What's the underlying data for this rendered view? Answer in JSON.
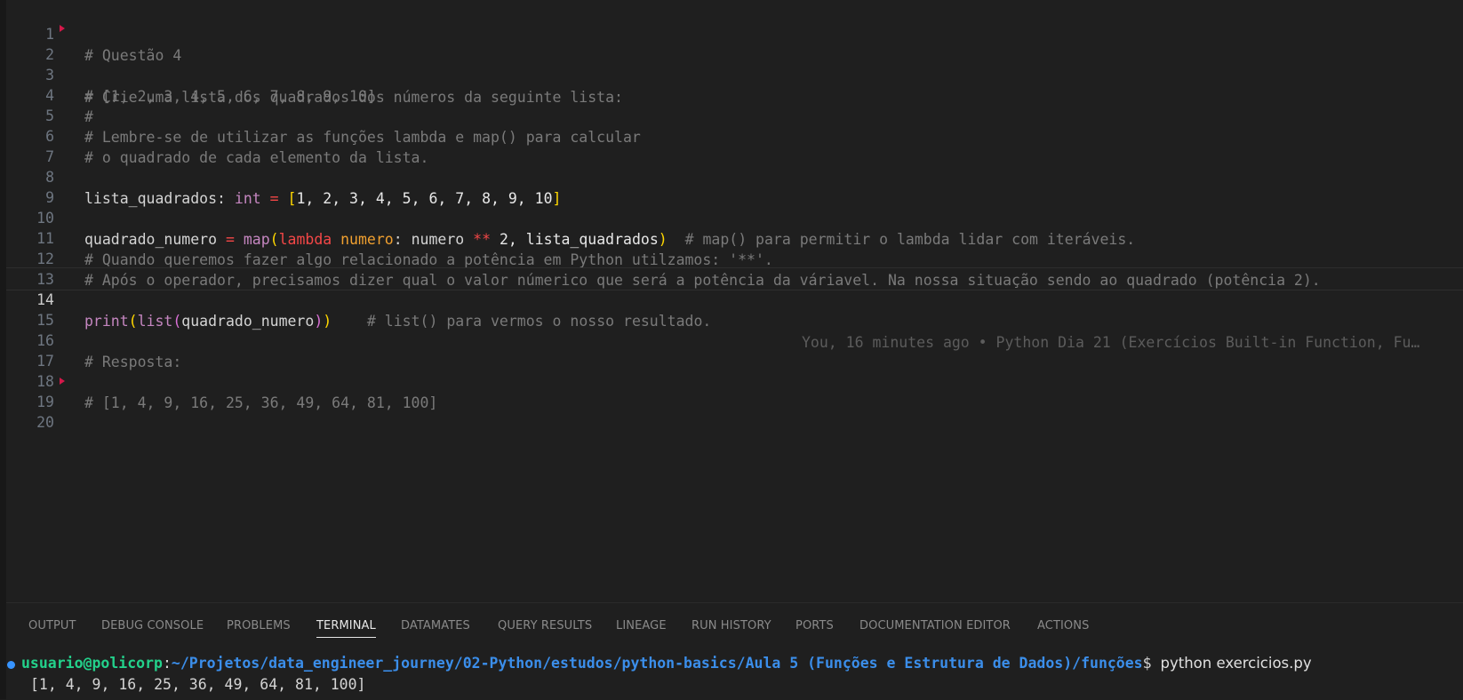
{
  "editor": {
    "active_line": 14,
    "lines": [
      {
        "n": "1",
        "comment": "# Questão 4"
      },
      {
        "n": "2",
        "comment": "# Crie uma lista dos quadrados dos números da seguinte lista:"
      },
      {
        "n": "3",
        "comment": "# [1, 2, 3, 4, 5, 6, 7, 8, 9, 10]"
      },
      {
        "n": "4",
        "comment": "#"
      },
      {
        "n": "5",
        "comment": "# Lembre-se de utilizar as funções lambda e map() para calcular"
      },
      {
        "n": "6",
        "comment": "# o quadrado de cada elemento da lista."
      },
      {
        "n": "7",
        "comment": ""
      },
      {
        "n": "8"
      },
      {
        "n": "9",
        "comment": ""
      },
      {
        "n": "10"
      },
      {
        "n": "11",
        "comment": "# Quando queremos fazer algo relacionado a potência em Python utilzamos: '**'."
      },
      {
        "n": "12",
        "comment": "# Após o operador, precisamos dizer qual o valor númerico que será a potência da váriavel. Na nossa situação sendo ao quadrado (potência 2)."
      },
      {
        "n": "13",
        "comment": ""
      },
      {
        "n": "14"
      },
      {
        "n": "15",
        "comment": ""
      },
      {
        "n": "16",
        "comment": "# Resposta:"
      },
      {
        "n": "17",
        "comment": ""
      },
      {
        "n": "18",
        "comment": "# [1, 4, 9, 16, 25, 36, 49, 64, 81, 100]"
      },
      {
        "n": "19",
        "comment": ""
      },
      {
        "n": "20",
        "comment": ""
      }
    ],
    "line8": {
      "var": "lista_quadrados",
      "colon": ": ",
      "type": "int",
      "eq": " = ",
      "open": "[",
      "values": "1, 2, 3, 4, 5, 6, 7, 8, 9, 10",
      "close": "]"
    },
    "line10": {
      "var": "quadrado_numero",
      "eq": " = ",
      "fn": "map",
      "open": "(",
      "lambda": "lambda",
      "param": " numero",
      "colon": ": ",
      "body": "numero ",
      "op": "**",
      "num": " 2, lista_quadrados",
      "close": ")",
      "comment": "  # map() para permitir o lambda lidar com iteráveis."
    },
    "line14": {
      "fn": "print",
      "open1": "(",
      "fn2": "list",
      "open2": "(",
      "arg": "quadrado_numero",
      "close2": ")",
      "close1": ")",
      "comment": "    # list() para vermos o nosso resultado.",
      "blame": "You, 16 minutes ago • Python Dia 21 (Exercícios Built-in Function, Fu…"
    }
  },
  "panel": {
    "tabs": [
      "OUTPUT",
      "DEBUG CONSOLE",
      "PROBLEMS",
      "TERMINAL",
      "DATAMATES",
      "QUERY RESULTS",
      "LINEAGE",
      "RUN HISTORY",
      "PORTS",
      "DOCUMENTATION EDITOR",
      "ACTIONS"
    ],
    "active_tab": "TERMINAL",
    "terminal": {
      "user": "usuario@policorp",
      "sep": ":",
      "path": "~/Projetos/data_engineer_journey/02-Python/estudos/python-basics/Aula 5 (Funções e Estrutura de Dados)/funções",
      "prompt": "$ ",
      "command": "python exercicios.py",
      "output": "[1, 4, 9, 16, 25, 36, 49, 64, 81, 100]"
    }
  },
  "colors": {
    "accent": "#3794ff",
    "user": "#23d18b",
    "path": "#3b8eea",
    "marker": "#d4184a"
  }
}
